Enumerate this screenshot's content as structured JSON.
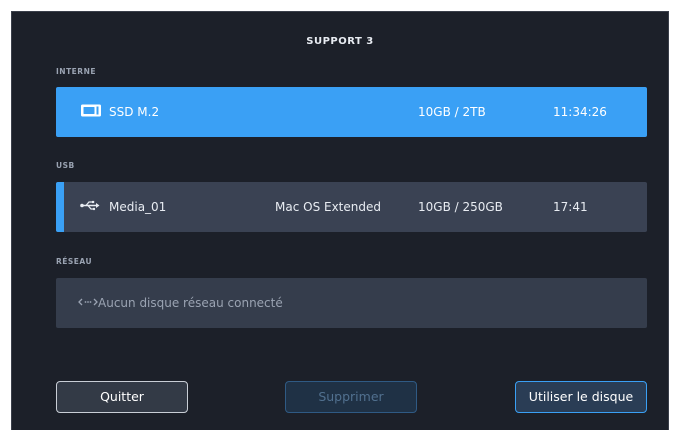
{
  "title": "SUPPORT 3",
  "sections": {
    "internal": {
      "label": "INTERNE",
      "name": "SSD M.2",
      "format": "",
      "capacity": "10GB / 2TB",
      "time": "11:34:26"
    },
    "usb": {
      "label": "USB",
      "name": "Media_01",
      "format": "Mac OS Extended",
      "capacity": "10GB / 250GB",
      "time": "17:41"
    },
    "network": {
      "label": "RÉSEAU",
      "message": "Aucun disque réseau connecté"
    }
  },
  "buttons": {
    "quit": "Quitter",
    "delete": "Supprimer",
    "use": "Utiliser le disque"
  },
  "colors": {
    "accent": "#3aa0f5",
    "panel_bg": "#1c2029",
    "row_bg": "#3a4253"
  },
  "icons": {
    "internal": "ssd-icon",
    "usb": "usb-icon",
    "network": "network-icon"
  }
}
